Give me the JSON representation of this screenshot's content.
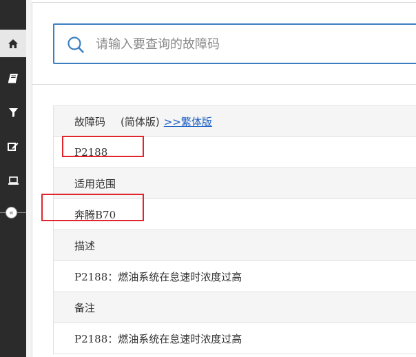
{
  "sidebar": {
    "items": [
      {
        "icon": "home-icon"
      },
      {
        "icon": "book-icon"
      },
      {
        "icon": "filter-icon"
      },
      {
        "icon": "edit-icon"
      },
      {
        "icon": "laptop-icon"
      }
    ],
    "collapse_glyph": "«"
  },
  "search": {
    "placeholder": "请输入要查询的故障码"
  },
  "table": {
    "code_label": "故障码",
    "simplified_label": "(简体版)",
    "traditional_link": ">>繁体版",
    "code_value": "P2188",
    "scope_label": "适用范围",
    "scope_value": "奔腾B70",
    "desc_label": "描述",
    "desc_value": "P2188：燃油系统在怠速时浓度过高",
    "note_label": "备注",
    "note_value": "P2188：燃油系统在怠速时浓度过高"
  },
  "colors": {
    "sidebar_bg": "#2b2b2b",
    "accent_blue": "#3c7fc1",
    "link": "#1a5ec4",
    "highlight_red": "#e0252d",
    "row_header_bg": "#f5f5f5"
  }
}
